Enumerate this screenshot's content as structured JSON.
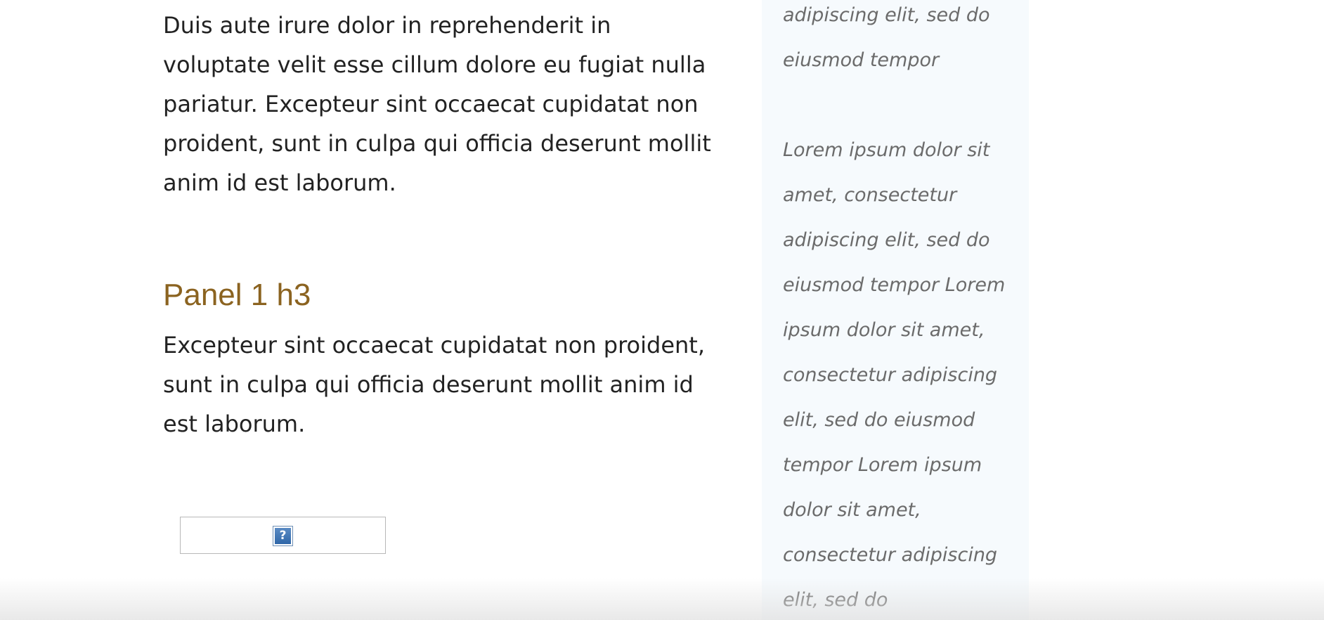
{
  "main": {
    "paragraph_1": "Duis aute irure dolor in reprehenderit in voluptate velit esse cillum dolore eu fugiat nulla pariatur. Excepteur sint occaecat cupidatat non proident, sunt in culpa qui officia deserunt mollit anim id est laborum.",
    "panel_heading": "Panel 1 h3",
    "paragraph_2": "Excepteur sint occaecat cupidatat non proident, sunt in culpa qui officia deserunt mollit anim id est laborum.",
    "broken_image_glyph": "?"
  },
  "sidebar": {
    "text_top": "adipiscing elit, sed do eiusmod tempor",
    "text_main": "Lorem ipsum dolor sit amet, consectetur adipiscing elit, sed do eiusmod tempor Lorem ipsum dolor sit amet, consectetur adipiscing elit, sed do eiusmod tempor Lorem ipsum dolor sit amet, consectetur adipiscing elit, sed do"
  },
  "colors": {
    "heading": "#8b6320",
    "body_text": "#222222",
    "sidebar_text": "#6b6b6b",
    "sidebar_background": "#f6fafd"
  },
  "icons": {
    "broken_image": "question-mark-icon"
  }
}
